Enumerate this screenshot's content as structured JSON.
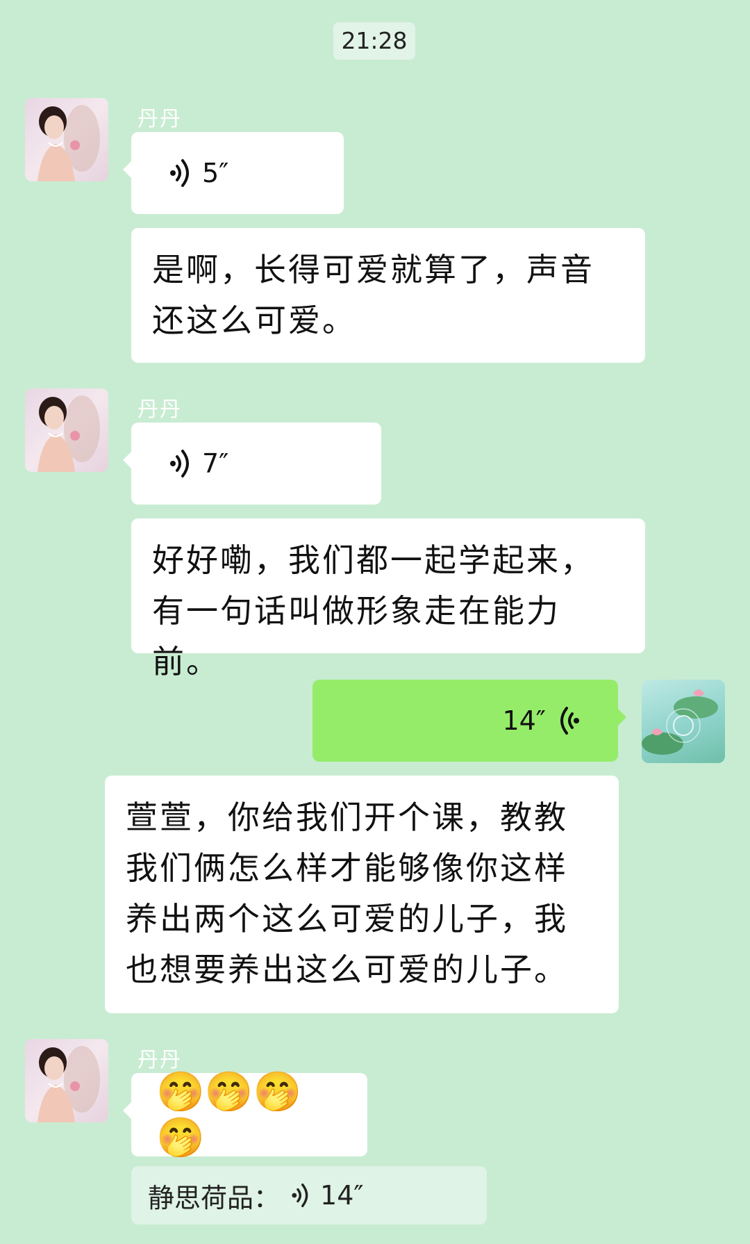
{
  "timestamp": "21:28",
  "contact_name": "丹丹",
  "messages": [
    {
      "voice_duration": "5″"
    },
    {
      "text": "是啊，长得可爱就算了，声音还这么可爱。"
    },
    {
      "voice_duration": "7″"
    },
    {
      "text": "好好嘞，我们都一起学起来，有一句话叫做形象走在能力前。"
    },
    {
      "voice_duration": "14″"
    },
    {
      "text": "萱萱，你给我们开个课，教教我们俩怎么样才能够像你这样养出两个这么可爱的儿子，我也想要养出这么可爱的儿子。"
    },
    {
      "emojis": "🤭🤭🤭🤭"
    }
  ],
  "quote": {
    "sender": "静思荷品：",
    "voice_duration": "14″"
  },
  "icons": {
    "voice": "voice-wave-icon",
    "avatar_other": "avatar-woman",
    "avatar_self": "avatar-lotus"
  },
  "colors": {
    "background": "#c8ecd2",
    "bubble_in": "#ffffff",
    "bubble_out": "#95ec69"
  }
}
